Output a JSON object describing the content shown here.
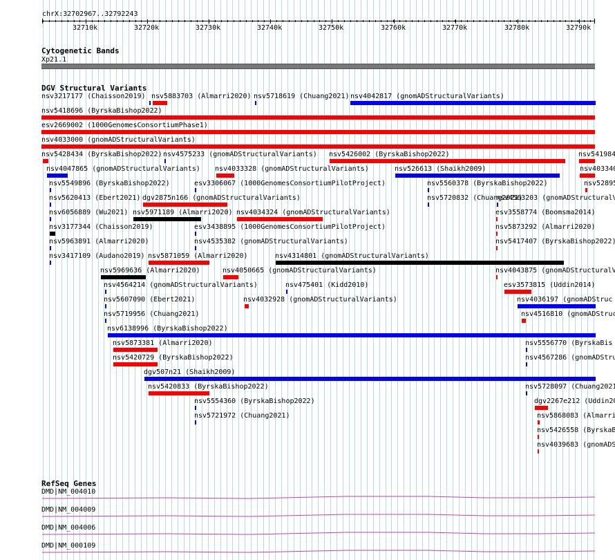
{
  "ruler": {
    "coord_label": "chrX:32702967..32792243",
    "start": 32702967,
    "end": 32792243,
    "ticks": [
      "32710k",
      "32720k",
      "32730k",
      "32740k",
      "32750k",
      "32760k",
      "32770k",
      "32780k",
      "32790k"
    ]
  },
  "cytoband": {
    "title": "Cytogenetic Bands",
    "band": "Xp21.1"
  },
  "dgv": {
    "title": "DGV Structural Variants",
    "features": [
      {
        "label": "nsv3217177 (Chaisson2019)",
        "color": "#0000ff",
        "row": 0
      },
      {
        "label": "nsv5883703 (Almarri2020)",
        "color": "#ff0000",
        "row": 0
      },
      {
        "label": "nsv5718619 (Chuang2021)",
        "color": "#0000ff",
        "row": 0
      },
      {
        "label": "nsv4042817 (gnomADStructuralVariants)",
        "color": "#0000ff",
        "row": 0
      },
      {
        "label": "nsv5418696 (ByrskaBishop2022)",
        "color": "#ff0000",
        "row": 1
      },
      {
        "label": "esv2669002 (1000GenomesConsortiumPhase1)",
        "color": "#ff0000",
        "row": 2
      },
      {
        "label": "nsv4033000 (gnomADStructuralVariants)",
        "color": "#ff0000",
        "row": 3
      },
      {
        "label": "nsv5428434 (ByrskaBishop2022)",
        "color": "#ff0000",
        "row": 4
      },
      {
        "label": "nsv4575233 (gnomADStructuralVariants)",
        "color": "#0000ff",
        "row": 4
      },
      {
        "label": "nsv5426002 (ByrskaBishop2022)",
        "color": "#ff0000",
        "row": 4
      },
      {
        "label": "nsv541984",
        "color": "#ff0000",
        "row": 4
      },
      {
        "label": "nsv4047865 (gnomADStructuralVariants)",
        "color": "#0000ff",
        "row": 5
      },
      {
        "label": "nsv4033328 (gnomADStructuralVariants)",
        "color": "#ff0000",
        "row": 5
      },
      {
        "label": "nsv526613 (Shaikh2009)",
        "color": "#0000ff",
        "row": 5
      },
      {
        "label": "nsv403340",
        "color": "#ff0000",
        "row": 5
      },
      {
        "label": "nsv5549896 (ByrskaBishop2022)",
        "color": "#0000ff",
        "row": 6
      },
      {
        "label": "esv3306067 (1000GenomesConsortiumPilotProject)",
        "color": "#0000ff",
        "row": 6
      },
      {
        "label": "nsv5560378 (ByrskaBishop2022)",
        "color": "#0000ff",
        "row": 6
      },
      {
        "label": "nsv52895",
        "color": "#ff0000",
        "row": 6
      },
      {
        "label": "nsv5620413 (Ebert2021)",
        "color": "#0000ff",
        "row": 7
      },
      {
        "label": "dgv2875n166 (gnomADStructuralVariants)",
        "color": "#ff0000",
        "row": 7
      },
      {
        "label": "nsv5720832 (Chuang2021)",
        "color": "#0000ff",
        "row": 7
      },
      {
        "label": "nsv4563203 (gnomADStructuralVariants)",
        "color": "#0000ff",
        "row": 7
      },
      {
        "label": "nsv6056889 (Wu2021)",
        "color": "#0000ff",
        "row": 8
      },
      {
        "label": "nsv5971189 (Almarri2020)",
        "color": "#000000",
        "row": 8
      },
      {
        "label": "nsv4034324 (gnomADStructuralVariants)",
        "color": "#ff0000",
        "row": 8
      },
      {
        "label": "esv3558774 (Boomsma2014)",
        "color": "#ff0000",
        "row": 8
      },
      {
        "label": "nsv3177344 (Chaisson2019)",
        "color": "#000000",
        "row": 9
      },
      {
        "label": "esv3438895 (1000GenomesConsortiumPilotProject)",
        "color": "#0000ff",
        "row": 9
      },
      {
        "label": "nsv5873292 (Almarri2020)",
        "color": "#ff0000",
        "row": 9
      },
      {
        "label": "nsv5963891 (Almarri2020)",
        "color": "#0000ff",
        "row": 10
      },
      {
        "label": "nsv4535382 (gnomADStructuralVariants)",
        "color": "#0000ff",
        "row": 10
      },
      {
        "label": "nsv5417407 (ByrskaBishop2022)",
        "color": "#ff0000",
        "row": 10
      },
      {
        "label": "nsv3417109 (Audano2019)",
        "color": "#0000ff",
        "row": 11
      },
      {
        "label": "nsv5871059 (Almarri2020)",
        "color": "#ff0000",
        "row": 11
      },
      {
        "label": "nsv4314801 (gnomADStructuralVariants)",
        "color": "#000000",
        "row": 11
      },
      {
        "label": "nsv5969636 (Almarri2020)",
        "color": "#000000",
        "row": 12
      },
      {
        "label": "nsv4050665 (gnomADStructuralVariants)",
        "color": "#ff0000",
        "row": 12
      },
      {
        "label": "nsv4043875 (gnomADStructuralV",
        "color": "#ff0000",
        "row": 12
      },
      {
        "label": "nsv4564214 (gnomADStructuralVariants)",
        "color": "#0000ff",
        "row": 13
      },
      {
        "label": "nsv475401 (Kidd2010)",
        "color": "#0000ff",
        "row": 13
      },
      {
        "label": "esv3573815 (Uddin2014)",
        "color": "#ff0000",
        "row": 13
      },
      {
        "label": "nsv5607090 (Ebert2021)",
        "color": "#0000ff",
        "row": 14
      },
      {
        "label": "nsv4032928 (gnomADStructuralVariants)",
        "color": "#ff0000",
        "row": 14
      },
      {
        "label": "nsv4036197 (gnomADStruc",
        "color": "#0000ff",
        "row": 14
      },
      {
        "label": "nsv5719956 (Chuang2021)",
        "color": "#0000ff",
        "row": 15
      },
      {
        "label": "nsv4516810 (gnomADStruc",
        "color": "#ff0000",
        "row": 15
      },
      {
        "label": "nsv6138996 (ByrskaBishop2022)",
        "color": "#0000ff",
        "row": 16
      },
      {
        "label": "nsv5873381 (Almarri2020)",
        "color": "#ff0000",
        "row": 17
      },
      {
        "label": "nsv5556770 (ByrskaBis",
        "color": "#0000ff",
        "row": 17
      },
      {
        "label": "nsv5420729 (ByrskaBishop2022)",
        "color": "#ff0000",
        "row": 18
      },
      {
        "label": "nsv4567286 (gnomADStru",
        "color": "#0000ff",
        "row": 18
      },
      {
        "label": "dgv507n21 (Shaikh2009)",
        "color": "#0000ff",
        "row": 19
      },
      {
        "label": "nsv5420833 (ByrskaBishop2022)",
        "color": "#ff0000",
        "row": 20
      },
      {
        "label": "nsv5728097 (Chuang2021",
        "color": "#0000ff",
        "row": 20
      },
      {
        "label": "nsv5554360 (ByrskaBishop2022)",
        "color": "#0000ff",
        "row": 21
      },
      {
        "label": "dgv2267e212 (Uddin20",
        "color": "#ff0000",
        "row": 21
      },
      {
        "label": "nsv5721972 (Chuang2021)",
        "color": "#0000ff",
        "row": 22
      },
      {
        "label": "nsv5868083 (Almarri",
        "color": "#ff0000",
        "row": 22
      },
      {
        "label": "nsv5426558 (ByrskaB",
        "color": "#ff0000",
        "row": 23
      },
      {
        "label": "nsv4039683 (gnomADS",
        "color": "#ff0000",
        "row": 24
      }
    ]
  },
  "refseq": {
    "title": "RefSeq Genes",
    "genes": [
      "DMD|NM_004010",
      "DMD|NM_004009",
      "DMD|NM_004006",
      "DMD|NM_000109"
    ]
  },
  "colors": {
    "gain": "#0000ff",
    "loss": "#ff0000",
    "complex": "#000000",
    "gridline": "#b4dcdc",
    "gene_line": "#c040c0",
    "band_fill": "#787878"
  }
}
